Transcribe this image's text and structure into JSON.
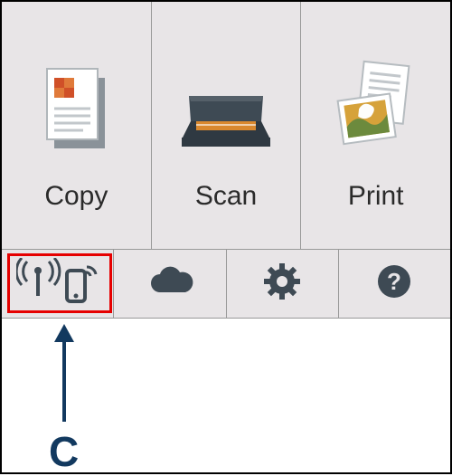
{
  "tiles": {
    "copy": {
      "label": "Copy",
      "icon": "copy-icon"
    },
    "scan": {
      "label": "Scan",
      "icon": "scanner-icon"
    },
    "print": {
      "label": "Print",
      "icon": "print-icon"
    }
  },
  "bottom": {
    "wireless": {
      "icon": "wireless-direct-icon"
    },
    "cloud": {
      "icon": "cloud-icon"
    },
    "settings": {
      "icon": "gear-icon"
    },
    "help": {
      "icon": "help-icon"
    }
  },
  "callout": {
    "label": "C"
  },
  "colors": {
    "highlight": "#e60000",
    "callout_text": "#12395f",
    "icon_dark": "#3e4a54",
    "background": "#e8e5e7"
  }
}
